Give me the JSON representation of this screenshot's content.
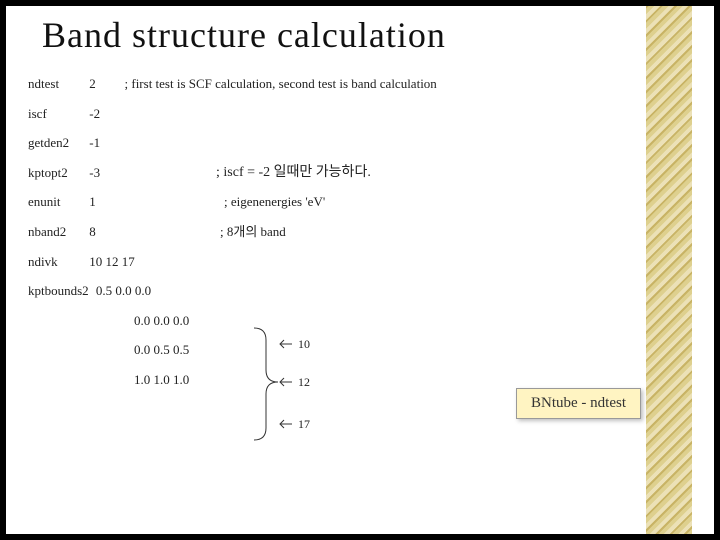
{
  "title": "Band structure calculation",
  "params": {
    "ndtest": {
      "key": "ndtest",
      "val": "2"
    },
    "iscf": {
      "key": "iscf",
      "val": "-2"
    },
    "getden2": {
      "key": "getden2",
      "val": "-1"
    },
    "kptopt2": {
      "key": "kptopt2",
      "val": "-3"
    },
    "enunit": {
      "key": "enunit",
      "val": "1"
    },
    "nband2": {
      "key": "nband2",
      "val": "8"
    },
    "ndivk": {
      "key": "ndivk",
      "val": "10 12 17"
    },
    "kptbounds2": {
      "key": "kptbounds2",
      "val": "0.5 0.0 0.0"
    }
  },
  "comments": {
    "ndtest": "; first test is SCF calculation, second test is band calculation",
    "kptopt2": ";  iscf = -2 일때만 가능하다.",
    "enunit": "; eigenenergies 'eV'",
    "nband2": "; 8개의  band"
  },
  "kptrows": {
    "r2": "0.0 0.0 0.0",
    "r3": "0.0 0.5 0.5",
    "r4": "1.0 1.0 1.0"
  },
  "arrows": {
    "a1": "10",
    "a2": "12",
    "a3": "17"
  },
  "callout": "BNtube - ndtest"
}
